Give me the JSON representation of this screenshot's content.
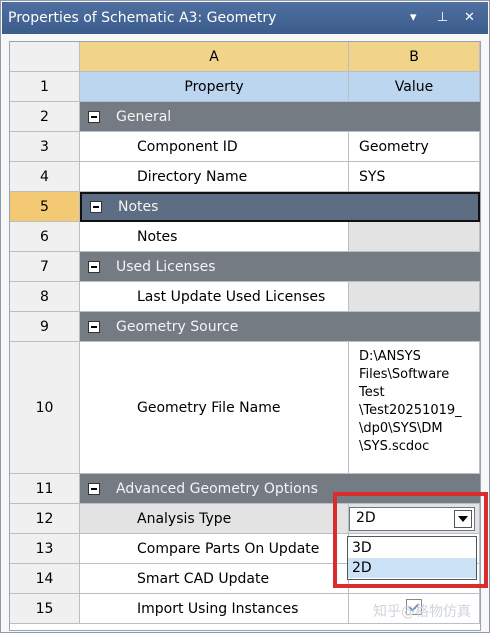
{
  "panel": {
    "title": "Properties of Schematic A3: Geometry",
    "pin_glyph": "↓",
    "dock_glyph": "Q",
    "close_glyph": "✕"
  },
  "columns": {
    "a": "A",
    "b": "B",
    "row1_a": "Property",
    "row1_b": "Value"
  },
  "rows": [
    {
      "n": "1"
    },
    {
      "n": "2"
    },
    {
      "n": "3"
    },
    {
      "n": "4"
    },
    {
      "n": "5"
    },
    {
      "n": "6"
    },
    {
      "n": "7"
    },
    {
      "n": "8"
    },
    {
      "n": "9"
    },
    {
      "n": "10"
    },
    {
      "n": "11"
    },
    {
      "n": "12"
    },
    {
      "n": "13"
    },
    {
      "n": "14"
    },
    {
      "n": "15"
    }
  ],
  "groups": {
    "general": "General",
    "notes": "Notes",
    "used_licenses": "Used Licenses",
    "geometry_source": "Geometry Source",
    "advanced": "Advanced Geometry Options"
  },
  "props": {
    "component_id": "Component ID",
    "component_id_val": "Geometry",
    "directory_name": "Directory Name",
    "directory_name_val": "SYS",
    "notes": "Notes",
    "last_update": "Last Update Used Licenses",
    "geometry_file": "Geometry File Name",
    "geometry_file_val": [
      "D:\\ANSYS",
      "Files\\Software",
      "Test",
      "\\Test20251019_",
      "\\dp0\\SYS\\DM",
      "\\SYS.scdoc"
    ],
    "analysis_type": "Analysis Type",
    "analysis_type_val": "2D",
    "compare_parts": "Compare Parts On Update",
    "smart_cad": "Smart CAD Update",
    "import_instances": "Import Using Instances"
  },
  "dropdown": {
    "options": [
      "3D",
      "2D"
    ],
    "highlighted": "2D"
  },
  "watermark": "知乎@格物仿真",
  "colors": {
    "title_bar": "#4e6f9f",
    "header_a": "#f1d38a",
    "header_b": "#bcd6ef",
    "group_row": "#757b82",
    "highlight_box": "#d92c2c"
  }
}
